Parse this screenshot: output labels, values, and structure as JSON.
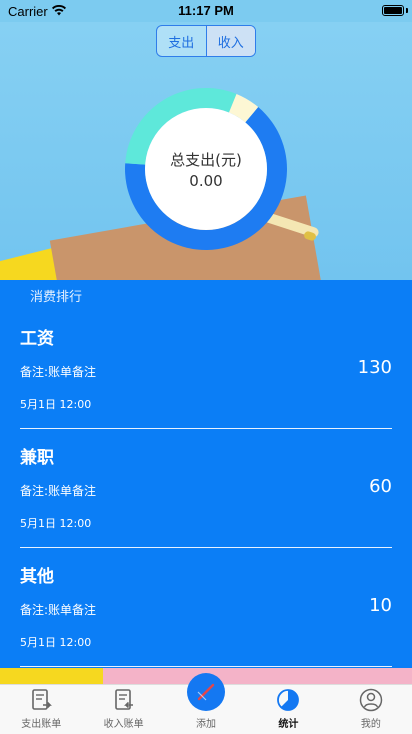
{
  "status_bar": {
    "carrier": "Carrier",
    "time": "11:17 PM"
  },
  "segment": {
    "items": [
      {
        "label": "支出",
        "active": false
      },
      {
        "label": "收入",
        "active": true
      }
    ]
  },
  "summary": {
    "label": "总支出(元)",
    "value": "0.00"
  },
  "chart_data": {
    "type": "pie",
    "categories": [
      "工资",
      "兼职",
      "其他"
    ],
    "values": [
      130,
      60,
      10
    ],
    "colors": [
      "#1e7cf2",
      "#5ee8da",
      "#fdf7d4"
    ]
  },
  "list": {
    "title": "消费排行",
    "records": [
      {
        "title": "工资",
        "note": "备注:账单备注",
        "amount": "130",
        "date": "5月1日 12:00"
      },
      {
        "title": "兼职",
        "note": "备注:账单备注",
        "amount": "60",
        "date": "5月1日 12:00"
      },
      {
        "title": "其他",
        "note": "备注:账单备注",
        "amount": "10",
        "date": "5月1日 12:00"
      }
    ]
  },
  "tabbar": {
    "items": [
      {
        "label": "支出账单",
        "icon": "bill-out-icon"
      },
      {
        "label": "收入账单",
        "icon": "bill-in-icon"
      },
      {
        "label": "添加",
        "icon": "pen-icon"
      },
      {
        "label": "统计",
        "icon": "pie-chart-icon",
        "active": true
      },
      {
        "label": "我的",
        "icon": "user-icon"
      }
    ]
  }
}
